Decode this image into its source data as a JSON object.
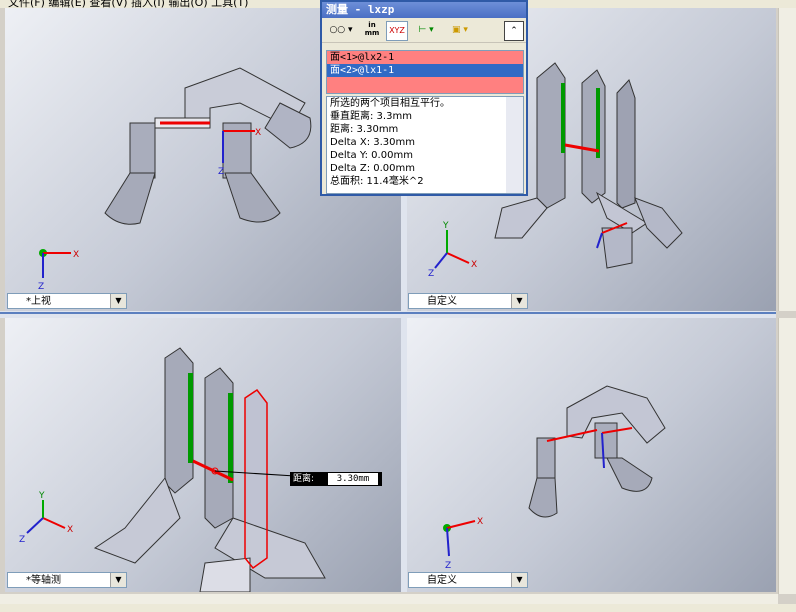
{
  "menu": {
    "items": "文件(F)  编辑(E)  查看(V)  插入(I)  输出(O)  工具(T)"
  },
  "measure_dialog": {
    "title": "测量 - lxzp",
    "toolbar": {
      "units_label": "in\nmm",
      "xyz_label": "XYZ"
    },
    "selections": [
      "面<1>@lx2-1",
      "面<2>@lx1-1"
    ],
    "results": [
      "所选的两个项目相互平行。",
      "垂直距离: 3.3mm",
      "距离: 3.30mm",
      "Delta X: 3.30mm",
      "Delta Y: 0.00mm",
      "Delta Z: 0.00mm",
      "总面积: 11.4毫米^2"
    ]
  },
  "viewports": {
    "top_left": {
      "view_name": "*上视"
    },
    "top_right": {
      "view_name": "自定义"
    },
    "bottom_left": {
      "view_name": "*等轴测"
    },
    "bottom_right": {
      "view_name": "自定义"
    }
  },
  "callout": {
    "label": "距离:",
    "value": "3.30mm"
  },
  "axes": {
    "x": "X",
    "y": "Y",
    "z": "Z"
  },
  "colors": {
    "title_blue": "#4a6fc4",
    "selection_red": "#ff8080",
    "selected_row": "#316ac5"
  }
}
